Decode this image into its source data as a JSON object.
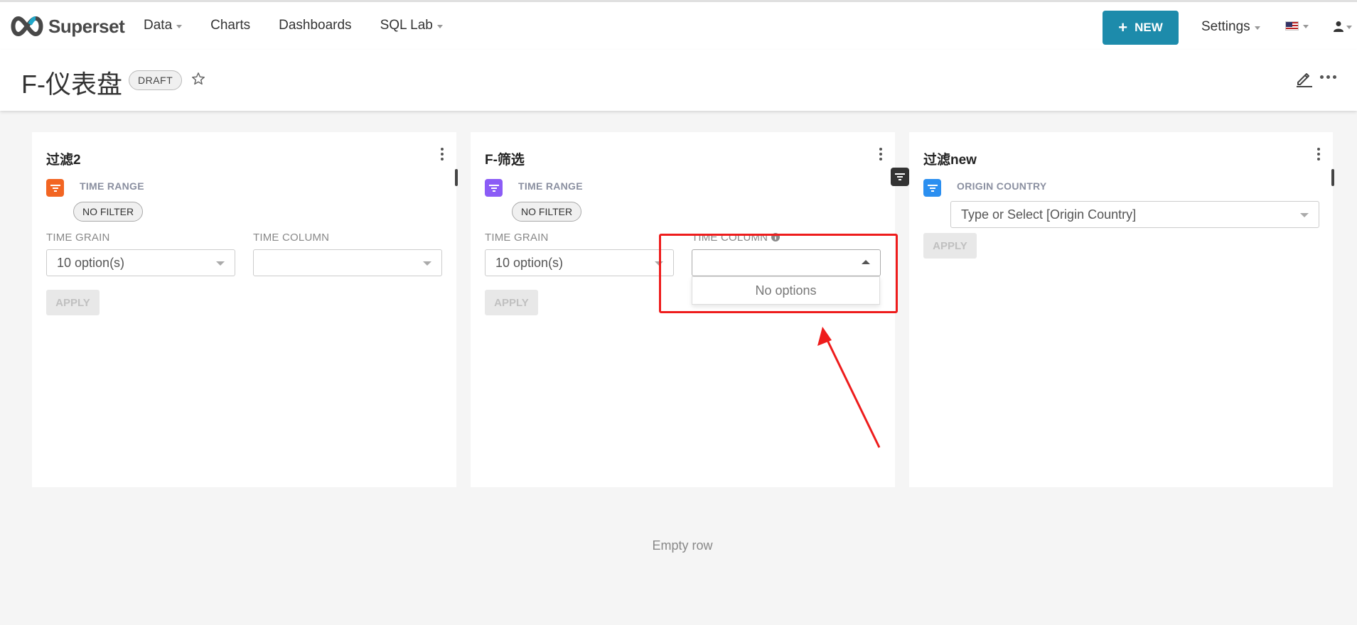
{
  "brand": {
    "name": "Superset"
  },
  "nav": {
    "items": [
      {
        "label": "Data",
        "has_caret": true
      },
      {
        "label": "Charts",
        "has_caret": false
      },
      {
        "label": "Dashboards",
        "has_caret": false
      },
      {
        "label": "SQL Lab",
        "has_caret": true
      }
    ],
    "new_label": "NEW",
    "settings_label": "Settings"
  },
  "header": {
    "title": "F-仪表盘",
    "status_badge": "DRAFT"
  },
  "cards": [
    {
      "title": "过滤2",
      "icon_color": "#f26522",
      "filter_label": "TIME RANGE",
      "nofilter_label": "NO FILTER",
      "time_grain_label": "TIME GRAIN",
      "time_grain_value": "10 option(s)",
      "time_column_label": "TIME COLUMN",
      "time_column_value": "",
      "apply_label": "APPLY"
    },
    {
      "title": "F-筛选",
      "icon_color": "#8b5cf6",
      "filter_label": "TIME RANGE",
      "nofilter_label": "NO FILTER",
      "time_grain_label": "TIME GRAIN",
      "time_grain_value": "10 option(s)",
      "time_column_label": "TIME COLUMN",
      "time_column_value": "",
      "apply_label": "APPLY",
      "dropdown_empty": "No options"
    },
    {
      "title": "过滤new",
      "icon_color": "#2b8ff0",
      "filter_label": "ORIGIN COUNTRY",
      "select_placeholder": "Type or Select [Origin Country]",
      "apply_label": "APPLY"
    }
  ],
  "empty_row_label": "Empty row",
  "colors": {
    "accent": "#1d8bab",
    "annotation": "#ee1c1c"
  }
}
